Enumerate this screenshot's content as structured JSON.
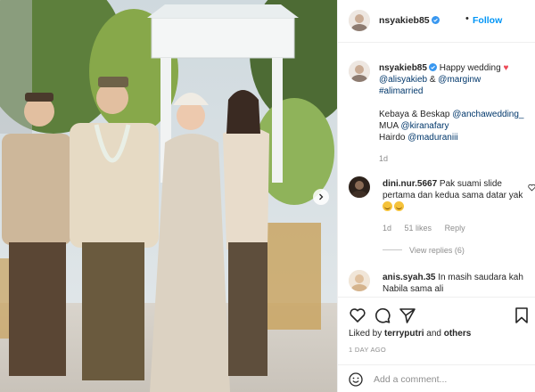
{
  "post": {
    "username": "nsyakieb85",
    "follow_label": "Follow",
    "dot": "•"
  },
  "caption": {
    "username": "nsyakieb85",
    "text1": "Happy wedding",
    "heart": "♥",
    "mention1": "@alisyakieb",
    "amp": "&",
    "mention2": "@marginw",
    "hashtag": "#alimarried",
    "line_kebaya_prefix": "Kebaya & Beskap",
    "mention_kebaya": "@anchawedding_",
    "line_mua_prefix": "MUA",
    "mention_mua": "@kiranafary",
    "line_hair_prefix": "Hairdo",
    "mention_hair": "@maduraniii",
    "time": "1d"
  },
  "comments": [
    {
      "username": "dini.nur.5667",
      "text": "Pak suami slide pertama dan kedua sama datar yak",
      "time": "1d",
      "likes": "51 likes",
      "reply": "Reply",
      "view_replies": "View replies (6)"
    },
    {
      "username": "anis.syah.35",
      "text": "In masih saudara kah Nabila sama ali"
    }
  ],
  "actions": {
    "liked_by_prefix": "Liked by",
    "liked_by_user": "terryputri",
    "liked_by_and": "and",
    "liked_by_others": "others",
    "time_ago": "1 DAY AGO"
  },
  "comment_box": {
    "placeholder": "Add a comment..."
  },
  "icons": {
    "verified": "verified-badge-icon",
    "heart": "heart-icon",
    "comment": "comment-icon",
    "share": "share-icon",
    "save": "bookmark-icon",
    "emoji": "smiley-icon",
    "next": "chevron-right-icon"
  },
  "colors": {
    "link": "#00376b",
    "follow": "#0095f6",
    "verified": "#3897f0",
    "like_heart": "#ed4956",
    "muted": "#8e8e8e"
  }
}
